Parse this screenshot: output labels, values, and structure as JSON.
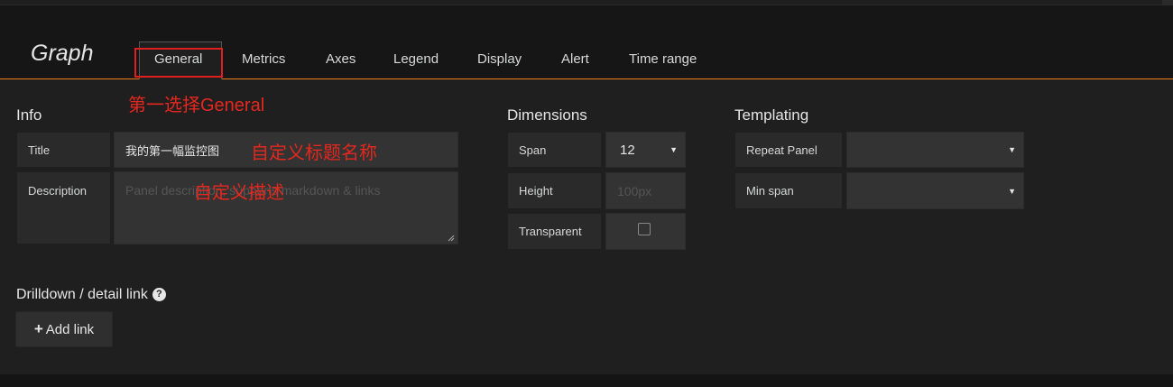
{
  "editor": {
    "title": "Graph",
    "tabs": [
      "General",
      "Metrics",
      "Axes",
      "Legend",
      "Display",
      "Alert",
      "Time range"
    ],
    "active_tab": "General"
  },
  "info": {
    "heading": "Info",
    "title_label": "Title",
    "title_value": "我的第一幅监控图",
    "description_label": "Description",
    "description_placeholder": "Panel description, supports markdown & links"
  },
  "dimensions": {
    "heading": "Dimensions",
    "span_label": "Span",
    "span_value": "12",
    "height_label": "Height",
    "height_placeholder": "100px",
    "transparent_label": "Transparent",
    "transparent_checked": false
  },
  "templating": {
    "heading": "Templating",
    "repeat_panel_label": "Repeat Panel",
    "repeat_panel_value": "",
    "min_span_label": "Min span",
    "min_span_value": ""
  },
  "drilldown": {
    "heading": "Drilldown / detail link",
    "help_icon": "?",
    "add_link_label": "Add link",
    "add_link_icon": "+"
  },
  "annotations": {
    "first": "第一选择General",
    "title": "自定义标题名称",
    "description": "自定义描述"
  },
  "colors": {
    "accent": "#eb7b18",
    "annotation": "#e5271e",
    "background": "#1f1f1f"
  }
}
